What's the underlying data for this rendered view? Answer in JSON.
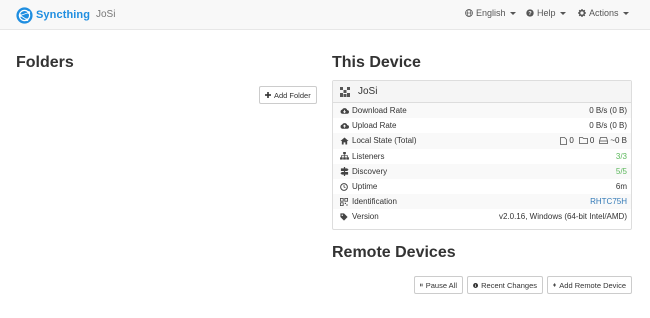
{
  "navbar": {
    "brand": "Syncthing",
    "device_name": "JoSi",
    "language": "English",
    "help": "Help",
    "actions": "Actions"
  },
  "folders": {
    "heading": "Folders",
    "add_button": "Add Folder"
  },
  "this_device": {
    "heading": "This Device",
    "name": "JoSi",
    "rows": [
      {
        "icon": "cloud-download-icon",
        "label": "Download Rate",
        "value": "0 B/s (0 B)"
      },
      {
        "icon": "cloud-upload-icon",
        "label": "Upload Rate",
        "value": "0 B/s (0 B)"
      },
      {
        "icon": "home-icon",
        "label": "Local State (Total)",
        "files": "0",
        "dirs": "0",
        "size": "~0 B"
      },
      {
        "icon": "sitemap-icon",
        "label": "Listeners",
        "value": "3/3"
      },
      {
        "icon": "signpost-icon",
        "label": "Discovery",
        "value": "5/5"
      },
      {
        "icon": "clock-icon",
        "label": "Uptime",
        "value": "6m"
      },
      {
        "icon": "qrcode-icon",
        "label": "Identification",
        "value": "RHTC75H"
      },
      {
        "icon": "tag-icon",
        "label": "Version",
        "value": "v2.0.16, Windows (64-bit Intel/AMD)"
      }
    ]
  },
  "remote_devices": {
    "heading": "Remote Devices",
    "pause_all": "Pause All",
    "recent_changes": "Recent Changes",
    "add_remote": "Add Remote Device"
  },
  "colors": {
    "brand": "#1f8ee0",
    "ok_green": "#5cb85c",
    "link_blue": "#337ab7"
  }
}
